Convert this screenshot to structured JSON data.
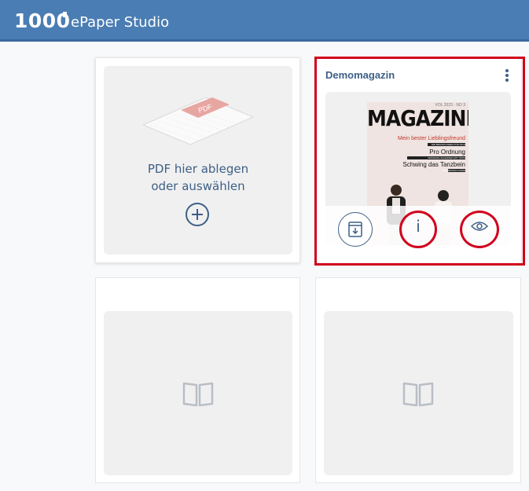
{
  "header": {
    "logo_number": "1000",
    "app_name": "ePaper Studio",
    "bg_color": "#4a7db3"
  },
  "upload_card": {
    "file_badge": "PDF",
    "line1": "PDF hier ablegen",
    "line2": "oder auswählen",
    "icon": "plus-circle-icon"
  },
  "magazine_card": {
    "title": "Demomagazin",
    "menu_icon": "kebab-menu-icon",
    "cover": {
      "masthead": "MAGAZINE",
      "vol": "VOL 2023 · NO 3",
      "headline1": "Mein bester Lieblingsfreund",
      "tag1": "DIE BESTEN IDEEN FÜR DICH",
      "headline2": "Pro Ordnung",
      "tag2": "ORDNUNG SCHAFFEN MIT TIPPS",
      "headline3": "Schwing das Tanzbein",
      "tag3": "DIE BESTEN KURSE"
    },
    "actions": {
      "download_icon": "archive-download-icon",
      "info_label": "i",
      "view_icon": "eye-icon"
    },
    "highlight_color": "#d0021b"
  },
  "empty_cards": [
    {
      "icon": "book-icon"
    },
    {
      "icon": "book-icon"
    }
  ]
}
